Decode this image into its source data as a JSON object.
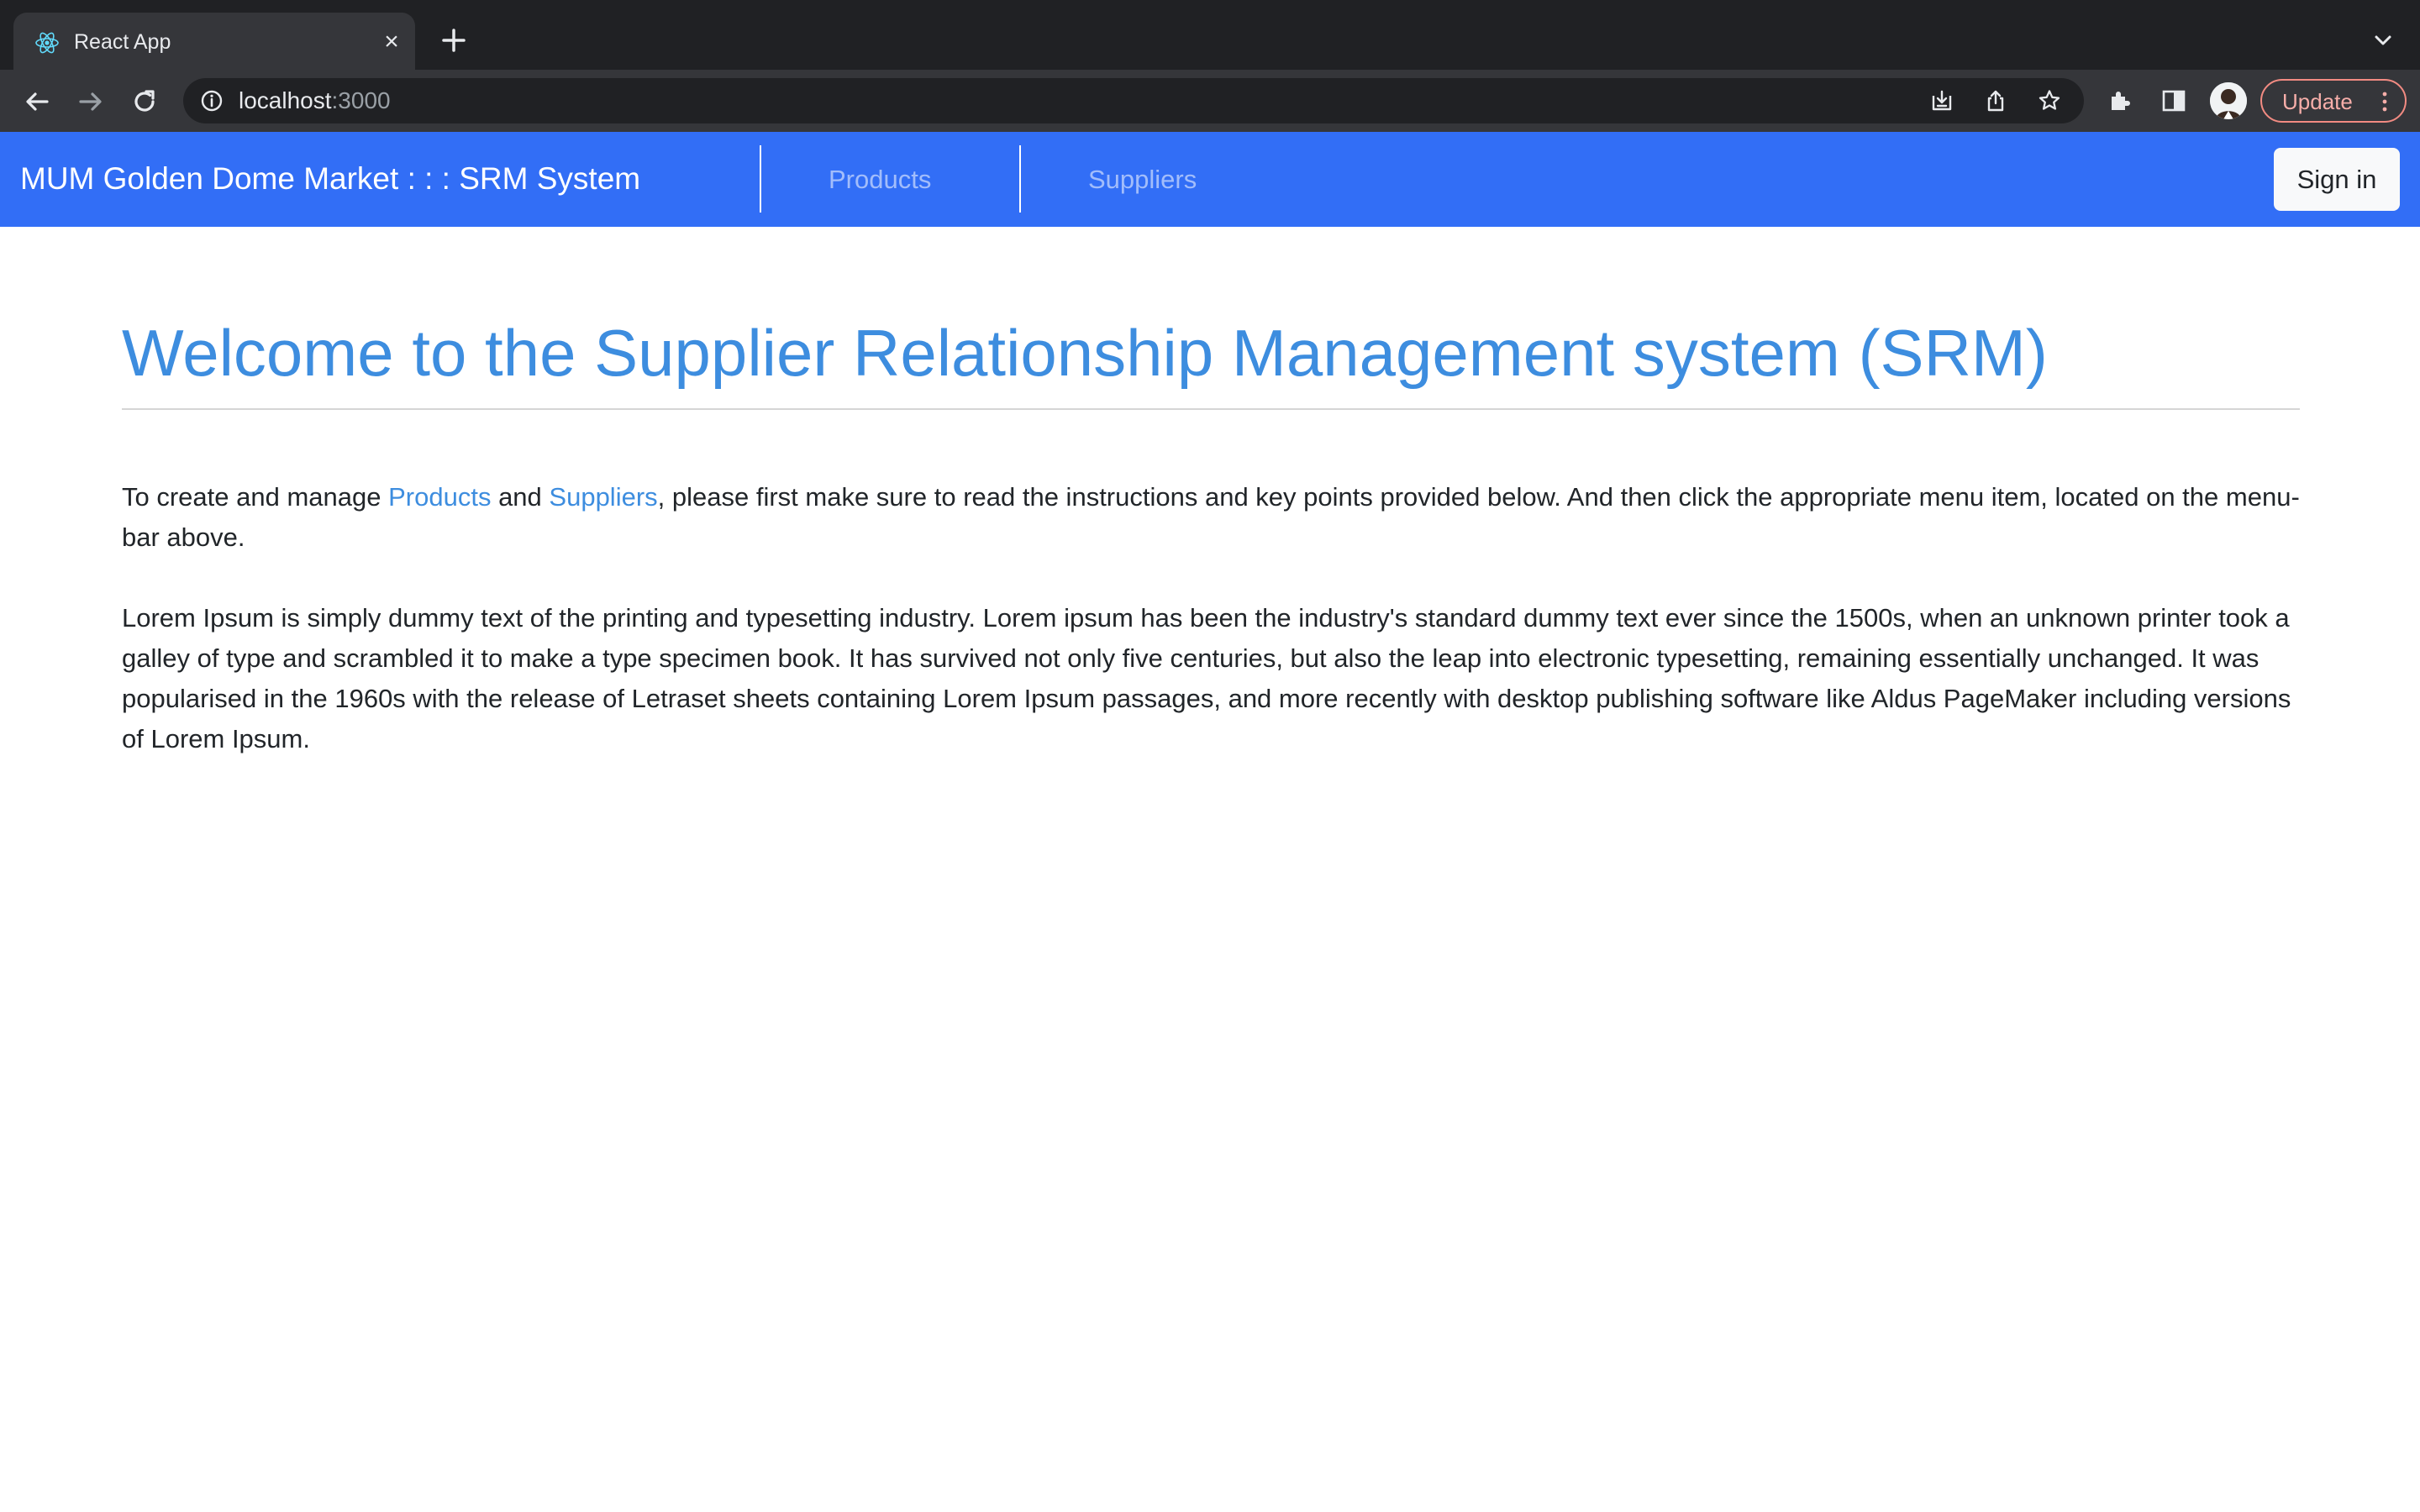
{
  "browser": {
    "tab_title": "React App",
    "url_host": "localhost",
    "url_port": ":3000",
    "update_label": "Update",
    "accent": "#f28b82"
  },
  "app": {
    "brand": "MUM Golden Dome Market : : : SRM System",
    "nav": [
      {
        "label": "Products"
      },
      {
        "label": "Suppliers"
      }
    ],
    "signin_label": "Sign in",
    "navbar_color": "#326ef6"
  },
  "content": {
    "heading": "Welcome to the Supplier Relationship Management system (SRM)",
    "intro": {
      "before": "To create and manage ",
      "link1": "Products",
      "middle": " and ",
      "link2": "Suppliers",
      "after": ", please first make sure to read the instructions and key points provided below. And then click the appropriate menu item, located on the menu-bar above."
    },
    "body": "Lorem Ipsum is simply dummy text of the printing and typesetting industry. Lorem ipsum has been the industry's standard dummy text ever since the 1500s, when an unknown printer took a galley of type and scrambled it to make a type specimen book. It has survived not only five centuries, but also the leap into electronic typesetting, remaining essentially unchanged. It was popularised in the 1960s with the release of Letraset sheets containing Lorem Ipsum passages, and more recently with desktop publishing software like Aldus PageMaker including versions of Lorem Ipsum.",
    "link_color": "#3d8ddf"
  }
}
